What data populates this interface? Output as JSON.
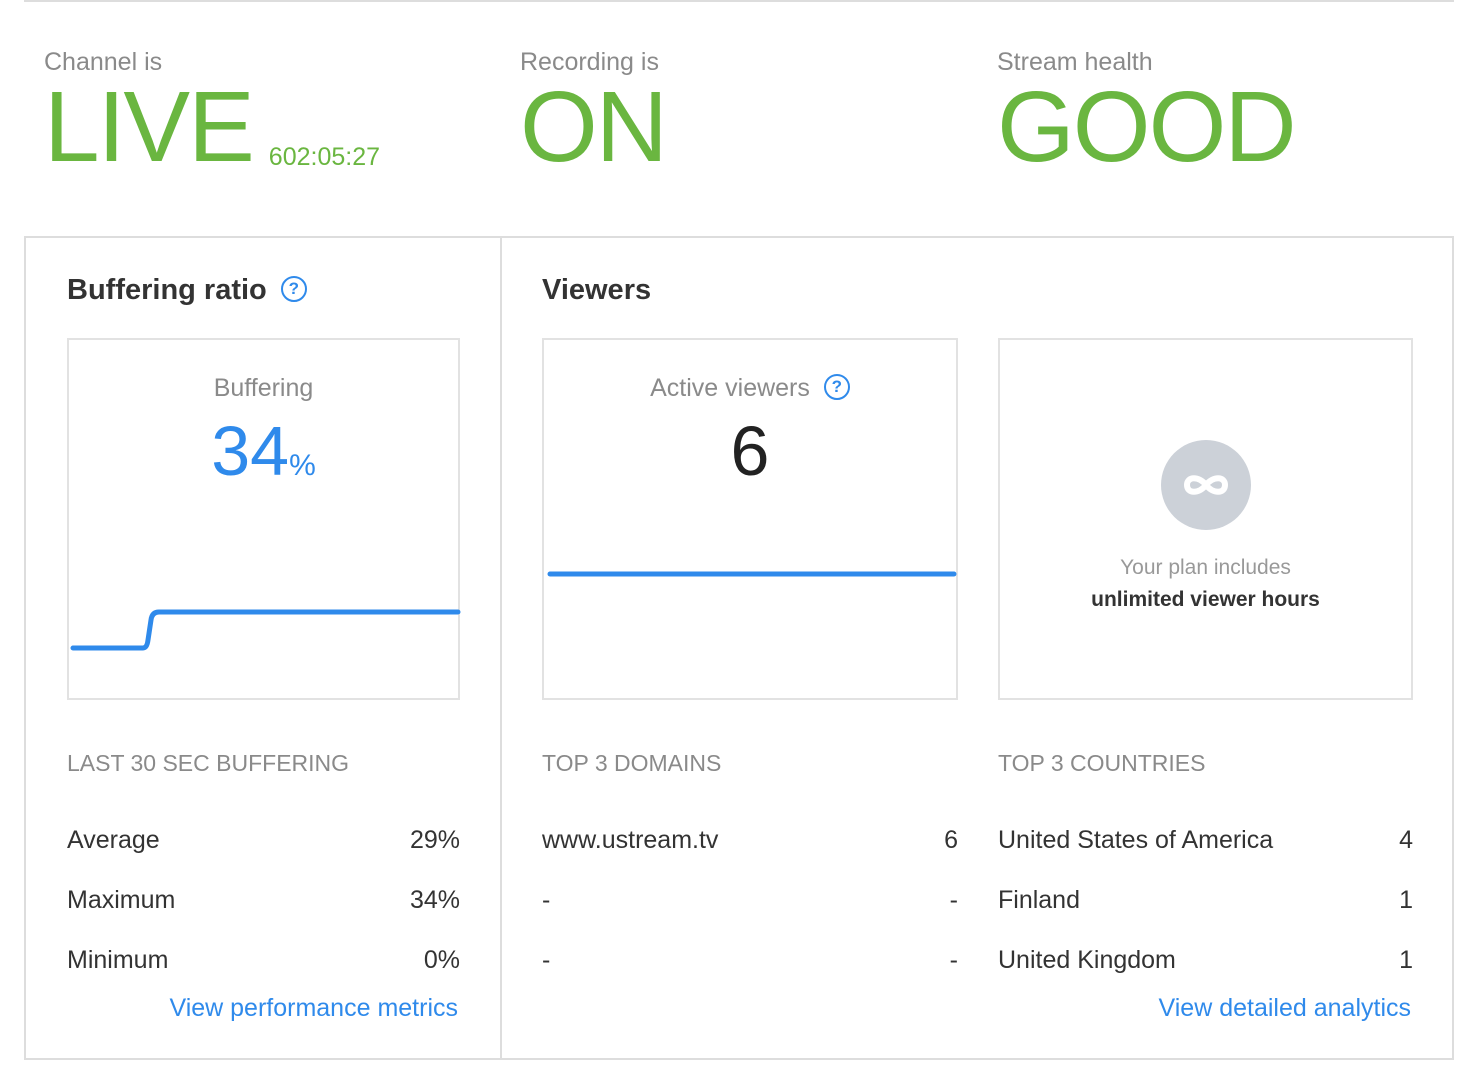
{
  "status": {
    "channel": {
      "label": "Channel is",
      "value": "LIVE",
      "timer": "602:05:27"
    },
    "recording": {
      "label": "Recording is",
      "value": "ON"
    },
    "health": {
      "label": "Stream health",
      "value": "GOOD"
    }
  },
  "buffering": {
    "title": "Buffering ratio",
    "help_icon": "question-circle-icon",
    "card_label": "Buffering",
    "value": "34",
    "unit": "%",
    "stats_heading": "LAST 30 SEC BUFFERING",
    "stats": [
      {
        "label": "Average",
        "value": "29%"
      },
      {
        "label": "Maximum",
        "value": "34%"
      },
      {
        "label": "Minimum",
        "value": "0%"
      }
    ],
    "link": "View performance metrics"
  },
  "viewers": {
    "title": "Viewers",
    "active_label": "Active viewers",
    "help_icon": "question-circle-icon",
    "active_value": "6",
    "plan_line1": "Your plan includes",
    "plan_line2": "unlimited viewer hours",
    "plan_icon": "infinity-icon",
    "domains_heading": "TOP 3 DOMAINS",
    "domains": [
      {
        "name": "www.ustream.tv",
        "count": "6"
      },
      {
        "name": "-",
        "count": "-"
      },
      {
        "name": "-",
        "count": "-"
      }
    ],
    "countries_heading": "TOP 3 COUNTRIES",
    "countries": [
      {
        "name": "United States of America",
        "count": "4"
      },
      {
        "name": "Finland",
        "count": "1"
      },
      {
        "name": "United Kingdom",
        "count": "1"
      }
    ],
    "link": "View detailed analytics"
  },
  "colors": {
    "live_green": "#6ab640",
    "accent_blue": "#2f8aeb",
    "border": "#dddddd",
    "muted_text": "#8a8a8a"
  }
}
